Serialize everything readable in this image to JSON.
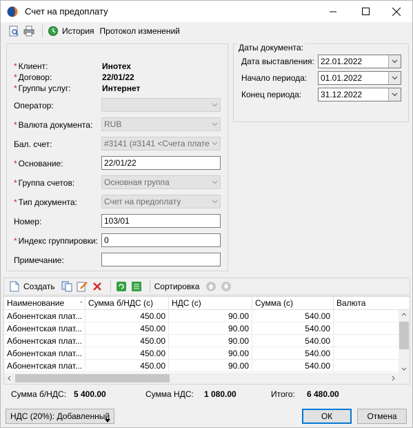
{
  "window": {
    "title": "Счет на предоплату"
  },
  "toolbar": {
    "history": "История",
    "changelog": "Протокол изменений"
  },
  "form": {
    "client_label": "Клиент:",
    "client_value": "Инотех",
    "contract_label": "Договор:",
    "contract_value": "22/01/22",
    "service_groups_label": "Группы услуг:",
    "service_groups_value": "Интернет",
    "operator_label": "Оператор:",
    "operator_value": "",
    "currency_label": "Валюта документа:",
    "currency_value": "RUB",
    "balance_label": "Бал. счет:",
    "balance_value": "#3141 (#3141 <Счета плате",
    "basis_label": "Основание:",
    "basis_value": "22/01/22",
    "invoice_group_label": "Группа счетов:",
    "invoice_group_value": "Основная группа",
    "doc_type_label": "Тип документа:",
    "doc_type_value": "Счет на предоплату",
    "number_label": "Номер:",
    "number_value": "103/01",
    "grouping_label": "Индекс группировки:",
    "grouping_value": "0",
    "note_label": "Примечание:",
    "note_value": ""
  },
  "dates": {
    "title": "Даты документа:",
    "issue_label": "Дата выставления:",
    "issue_value": "22.01.2022",
    "start_label": "Начало периода:",
    "start_value": "01.01.2022",
    "end_label": "Конец периода:",
    "end_value": "31.12.2022"
  },
  "gridbar": {
    "create": "Создать",
    "sort": "Сортировка"
  },
  "grid": {
    "columns": [
      "Наименование",
      "Сумма б/НДС (с)",
      "НДС (с)",
      "Сумма (с)",
      "Валюта"
    ],
    "rows": [
      [
        "Абонентская плат...",
        "450.00",
        "90.00",
        "540.00",
        ""
      ],
      [
        "Абонентская плат...",
        "450.00",
        "90.00",
        "540.00",
        ""
      ],
      [
        "Абонентская плат...",
        "450.00",
        "90.00",
        "540.00",
        ""
      ],
      [
        "Абонентская плат...",
        "450.00",
        "90.00",
        "540.00",
        ""
      ],
      [
        "Абонентская плат...",
        "450.00",
        "90.00",
        "540.00",
        ""
      ]
    ]
  },
  "totals": {
    "net_label": "Сумма б/НДС:",
    "net_value": "5 400.00",
    "vat_label": "Сумма НДС:",
    "vat_value": "1 080.00",
    "total_label": "Итого:",
    "total_value": "6 480.00"
  },
  "footer": {
    "vat_mode": "НДС (20%): Добавленный",
    "ok": "ОК",
    "cancel": "Отмена"
  },
  "colors": {
    "required": "#d02020",
    "accent": "#0078d7"
  }
}
